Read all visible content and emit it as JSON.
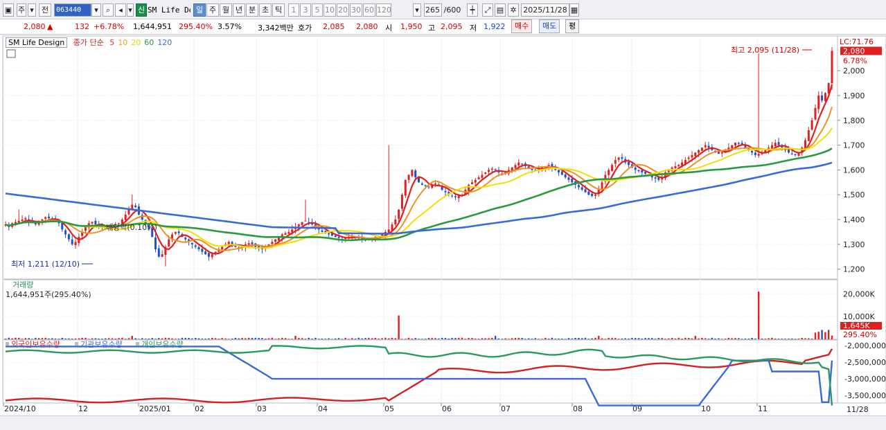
{
  "toolbar": {
    "market": "주",
    "prev_label": "전",
    "code": "063440",
    "new_label": "신",
    "name": "SM Life De",
    "periods": [
      "일",
      "주",
      "월",
      "년",
      "분",
      "초",
      "틱"
    ],
    "active_period": "일",
    "intervals": [
      "1",
      "3",
      "5",
      "10",
      "20",
      "30",
      "60",
      "120"
    ],
    "count": "265",
    "count_total": "/600",
    "date": "2025/11/28"
  },
  "quote": {
    "price": "2,080",
    "up_arrow": "▲",
    "change": "132",
    "change_pct": "+6.78%",
    "volume": "1,644,951",
    "volume_ratio": "295.40%",
    "turnover": "3.57%",
    "amount": "3,342백만",
    "ask_label": "호가",
    "ask": "2,085",
    "bid": "2,080",
    "open_label": "시",
    "open": "1,950",
    "high_label": "고",
    "high": "2,095",
    "low_label": "저",
    "low": "1,922",
    "buy_btn": "매수",
    "sell_btn": "매도",
    "eval_btn": "평"
  },
  "legend": {
    "title": "SM Life Design",
    "ma_label": "종가 단순",
    "ma_periods": [
      {
        "p": "5",
        "color": "#e03030"
      },
      {
        "p": "10",
        "color": "#f0a020"
      },
      {
        "p": "20",
        "color": "#e8d800"
      },
      {
        "p": "60",
        "color": "#2a9a40"
      },
      {
        "p": "120",
        "color": "#3a6ad8"
      }
    ]
  },
  "annotations": {
    "high": "최고 2,095 (11/28)",
    "low": "최저 1,211 (12/10)",
    "dividend": "배당락(0.10%)",
    "lc": "LC:71.76",
    "price_tag": "2,080",
    "pct_tag": "6.78%",
    "vol_title": "거래량",
    "vol_value": "1,644,951주(295.40%)",
    "vol_tag": "1,645K",
    "vol_pct_tag": "295.40%",
    "date_tag": "11/28"
  },
  "hold_legend": [
    "외국인보유수량",
    "기관보유수량",
    "개인보유수량"
  ],
  "chart_data": [
    {
      "type": "candlestick",
      "title": "SM Life Design",
      "ylim": [
        1160,
        2140
      ],
      "yticks": [
        1200,
        1300,
        1400,
        1500,
        1600,
        1700,
        1800,
        1900,
        2000
      ],
      "xticks": [
        "2024/10",
        "12",
        "2025/01",
        "02",
        "03",
        "04",
        "05",
        "06",
        "07",
        "08",
        "09",
        "10",
        "11"
      ],
      "last": {
        "date": "2025/11/28",
        "open": 1950,
        "high": 2095,
        "low": 1922,
        "close": 2080
      },
      "period_high": {
        "value": 2095,
        "date": "11/28"
      },
      "period_low": {
        "value": 1211,
        "date": "12/10"
      },
      "close": [
        1380,
        1370,
        1385,
        1390,
        1395,
        1400,
        1405,
        1390,
        1385,
        1380,
        1395,
        1400,
        1410,
        1405,
        1400,
        1395,
        1385,
        1360,
        1340,
        1320,
        1300,
        1310,
        1330,
        1350,
        1370,
        1385,
        1390,
        1380,
        1375,
        1370,
        1360,
        1365,
        1375,
        1380,
        1385,
        1400,
        1420,
        1440,
        1460,
        1450,
        1420,
        1400,
        1380,
        1360,
        1330,
        1280,
        1250,
        1260,
        1290,
        1320,
        1340,
        1350,
        1345,
        1330,
        1320,
        1310,
        1300,
        1290,
        1280,
        1270,
        1260,
        1250,
        1260,
        1270,
        1280,
        1290,
        1300,
        1310,
        1300,
        1290,
        1285,
        1290,
        1300,
        1305,
        1300,
        1290,
        1285,
        1280,
        1290,
        1300,
        1310,
        1320,
        1330,
        1340,
        1345,
        1350,
        1360,
        1370,
        1380,
        1390,
        1395,
        1390,
        1380,
        1370,
        1360,
        1350,
        1345,
        1340,
        1335,
        1330,
        1325,
        1320,
        1325,
        1330,
        1335,
        1330,
        1325,
        1320,
        1315,
        1320,
        1325,
        1330,
        1335,
        1340,
        1350,
        1360,
        1380,
        1400,
        1440,
        1500,
        1560,
        1580,
        1600,
        1570,
        1550,
        1540,
        1535,
        1530,
        1540,
        1545,
        1535,
        1520,
        1510,
        1500,
        1495,
        1490,
        1495,
        1500,
        1520,
        1540,
        1550,
        1560,
        1570,
        1580,
        1590,
        1600,
        1605,
        1600,
        1590,
        1580,
        1590,
        1600,
        1610,
        1620,
        1630,
        1625,
        1615,
        1605,
        1600,
        1600,
        1605,
        1610,
        1615,
        1620,
        1610,
        1600,
        1590,
        1580,
        1570,
        1560,
        1550,
        1540,
        1530,
        1520,
        1510,
        1500,
        1495,
        1500,
        1520,
        1550,
        1580,
        1600,
        1620,
        1640,
        1650,
        1645,
        1630,
        1620,
        1610,
        1600,
        1595,
        1590,
        1585,
        1580,
        1570,
        1565,
        1560,
        1570,
        1590,
        1600,
        1610,
        1615,
        1620,
        1630,
        1640,
        1650,
        1660,
        1670,
        1680,
        1690,
        1700,
        1690,
        1680,
        1670,
        1665,
        1670,
        1680,
        1690,
        1700,
        1710,
        1705,
        1700,
        1690,
        1680,
        1670,
        1660,
        1665,
        1670,
        1680,
        1690,
        1700,
        1710,
        1700,
        1690,
        1680,
        1670,
        1665,
        1660,
        1670,
        1690,
        1720,
        1760,
        1800,
        1850,
        1900,
        1880,
        1910,
        1950,
        2080
      ],
      "ma": [
        "MA5",
        "MA10",
        "MA20",
        "MA60",
        "MA120"
      ]
    },
    {
      "type": "bar",
      "title": "거래량",
      "ylim": [
        0,
        25000000
      ],
      "yticks": [
        "10,000K",
        "20,000K"
      ],
      "last_value": 1644951,
      "spikes": [
        {
          "date": "2025/04",
          "value": 10500000
        },
        {
          "date": "2025/10",
          "value": 21000000
        }
      ]
    },
    {
      "type": "line",
      "series": [
        {
          "name": "외국인보유수량",
          "color": "#d42020"
        },
        {
          "name": "기관보유수량",
          "color": "#3a6ad8"
        },
        {
          "name": "개인보유수량",
          "color": "#2a9a60"
        }
      ],
      "yticks": [
        "-2,000,000",
        "-2,500,000",
        "-3,000,000",
        "-3,500,000"
      ]
    }
  ]
}
